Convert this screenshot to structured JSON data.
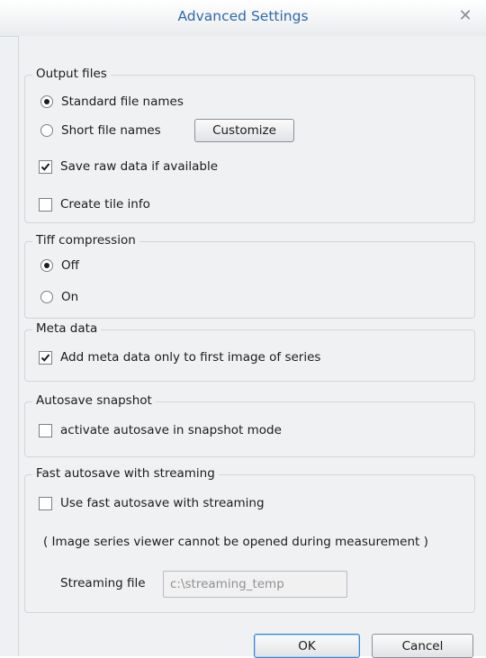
{
  "window": {
    "title": "Advanced Settings",
    "close_glyph": "✕"
  },
  "output_files": {
    "legend": "Output files",
    "standard_label": "Standard file names",
    "short_label": "Short file names",
    "customize_label": "Customize",
    "selected": "standard",
    "save_raw_label": "Save raw data if available",
    "save_raw_checked": true,
    "tile_info_label": "Create tile info",
    "tile_info_checked": false
  },
  "tiff": {
    "legend": "Tiff compression",
    "off_label": "Off",
    "on_label": "On",
    "selected": "off"
  },
  "meta": {
    "legend": "Meta data",
    "first_image_label": "Add meta data only to first image of series",
    "first_image_checked": true
  },
  "autosave": {
    "legend": "Autosave snapshot",
    "activate_label": "activate autosave in snapshot mode",
    "activate_checked": false
  },
  "fast_autosave": {
    "legend": "Fast autosave with streaming",
    "use_label": "Use fast autosave with streaming",
    "use_checked": false,
    "note": "( Image series viewer cannot be opened during measurement )",
    "streaming_file_label": "Streaming file",
    "streaming_file_value": "c:\\streaming_temp"
  },
  "buttons": {
    "ok_label": "OK",
    "cancel_label": "Cancel"
  },
  "icons": {
    "radio": "radio-button",
    "check": "checkbox",
    "close": "close-icon"
  }
}
